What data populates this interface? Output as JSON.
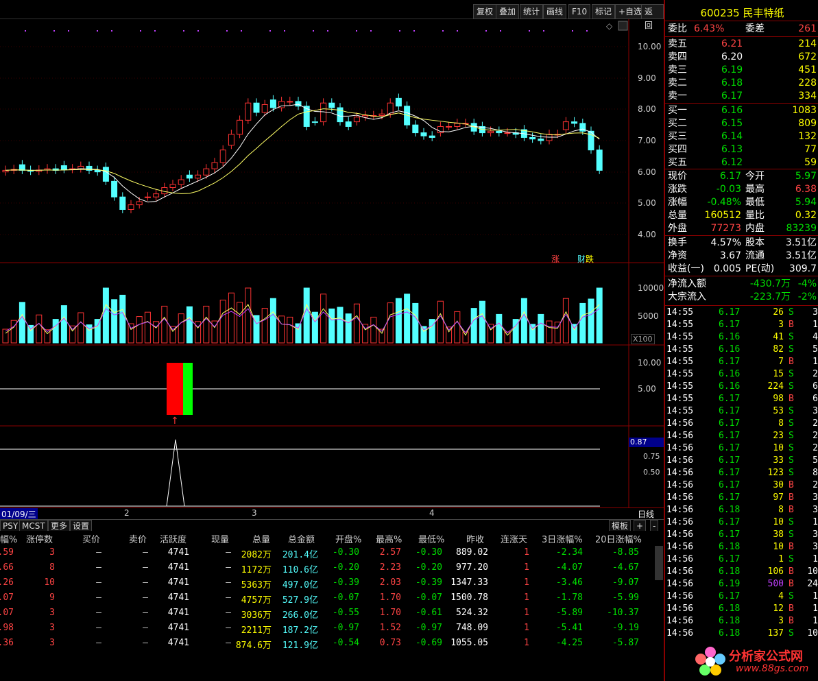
{
  "toolbar": {
    "buttons": [
      "复权",
      "叠加",
      "统计",
      "画线",
      "F10",
      "标记",
      "+自选",
      "返回"
    ]
  },
  "stock": {
    "code": "600235",
    "name": "民丰特纸"
  },
  "price_axis": [
    "10.00",
    "9.00",
    "8.00",
    "7.00",
    "6.00",
    "5.00",
    "4.00"
  ],
  "volume_axis": [
    "10000",
    "5000"
  ],
  "volume_unit": "X100",
  "indicator_axis": [
    "10.00",
    "5.00"
  ],
  "indicator_labels": {
    "up": "涨",
    "fin": "财",
    "down": "跌"
  },
  "pane4_axis": [
    "0.87",
    "0.75",
    "0.50"
  ],
  "date_axis": {
    "start": "01/09/三",
    "ticks": [
      "2",
      "3",
      "4"
    ],
    "period": "日线"
  },
  "tabs": [
    "PSY",
    "MCST",
    "更多",
    "设置"
  ],
  "tab_right": {
    "template": "模板",
    "plus": "+",
    "minus": "-"
  },
  "table": {
    "headers": [
      "幅%",
      "涨停数",
      "买价",
      "卖价",
      "活跃度",
      "现量",
      "总量",
      "总金额",
      "开盘%",
      "最高%",
      "最低%",
      "昨收",
      "连涨天",
      "3日涨幅%",
      "20日涨幅%"
    ],
    "rows": [
      [
        ".59",
        "3",
        "–",
        "–",
        "4741",
        "–",
        "2082万",
        "201.4亿",
        "-0.30",
        "2.57",
        "-0.30",
        "889.02",
        "1",
        "-2.34",
        "-8.85"
      ],
      [
        ".66",
        "8",
        "–",
        "–",
        "4741",
        "–",
        "1172万",
        "110.6亿",
        "-0.20",
        "2.23",
        "-0.20",
        "977.20",
        "1",
        "-4.07",
        "-4.67"
      ],
      [
        ".26",
        "10",
        "–",
        "–",
        "4741",
        "–",
        "5363万",
        "497.0亿",
        "-0.39",
        "2.03",
        "-0.39",
        "1347.33",
        "1",
        "-3.46",
        "-9.07"
      ],
      [
        ".07",
        "9",
        "–",
        "–",
        "4741",
        "–",
        "4757万",
        "527.9亿",
        "-0.07",
        "1.70",
        "-0.07",
        "1500.78",
        "1",
        "-1.78",
        "-5.99"
      ],
      [
        ".07",
        "3",
        "–",
        "–",
        "4741",
        "–",
        "3036万",
        "266.0亿",
        "-0.55",
        "1.70",
        "-0.61",
        "524.32",
        "1",
        "-5.89",
        "-10.37"
      ],
      [
        ".98",
        "3",
        "–",
        "–",
        "4741",
        "–",
        "2211万",
        "187.2亿",
        "-0.97",
        "1.52",
        "-0.97",
        "748.09",
        "1",
        "-5.41",
        "-9.19"
      ],
      [
        ".36",
        "3",
        "–",
        "–",
        "4741",
        "–",
        "874.6万",
        "121.9亿",
        "-0.54",
        "0.73",
        "-0.69",
        "1055.05",
        "1",
        "-4.25",
        "-5.87"
      ]
    ]
  },
  "orderbook": {
    "weibi_label": "委比",
    "weibi": "6.43%",
    "weicha_label": "委差",
    "weicha": "261",
    "sells": [
      [
        "卖五",
        "6.21",
        "214"
      ],
      [
        "卖四",
        "6.20",
        "672"
      ],
      [
        "卖三",
        "6.19",
        "451"
      ],
      [
        "卖二",
        "6.18",
        "228"
      ],
      [
        "卖一",
        "6.17",
        "334"
      ]
    ],
    "buys": [
      [
        "买一",
        "6.16",
        "1083"
      ],
      [
        "买二",
        "6.15",
        "809"
      ],
      [
        "买三",
        "6.14",
        "132"
      ],
      [
        "买四",
        "6.13",
        "77"
      ],
      [
        "买五",
        "6.12",
        "59"
      ]
    ]
  },
  "quote": [
    [
      "现价",
      "6.17",
      "今开",
      "5.97"
    ],
    [
      "涨跌",
      "-0.03",
      "最高",
      "6.38"
    ],
    [
      "涨幅",
      "-0.48%",
      "最低",
      "5.94"
    ],
    [
      "总量",
      "160512",
      "量比",
      "0.32"
    ],
    [
      "外盘",
      "77273",
      "内盘",
      "83239"
    ]
  ],
  "fundamentals": [
    [
      "换手",
      "4.57%",
      "股本",
      "3.51亿"
    ],
    [
      "净资",
      "3.67",
      "流通",
      "3.51亿"
    ],
    [
      "收益(一)",
      "0.005",
      "PE(动)",
      "309.7"
    ]
  ],
  "flows": [
    [
      "净流入额",
      "-430.7万",
      "-4%"
    ],
    [
      "大宗流入",
      "-223.7万",
      "-2%"
    ]
  ],
  "ticks": [
    [
      "14:55",
      "6.17",
      "26",
      "S",
      "3"
    ],
    [
      "14:55",
      "6.17",
      "3",
      "B",
      "1"
    ],
    [
      "14:55",
      "6.16",
      "41",
      "S",
      "4"
    ],
    [
      "14:55",
      "6.16",
      "82",
      "S",
      "5"
    ],
    [
      "14:55",
      "6.17",
      "7",
      "B",
      "1"
    ],
    [
      "14:55",
      "6.16",
      "15",
      "S",
      "2"
    ],
    [
      "14:55",
      "6.16",
      "224",
      "S",
      "6"
    ],
    [
      "14:55",
      "6.17",
      "98",
      "B",
      "6"
    ],
    [
      "14:55",
      "6.17",
      "53",
      "S",
      "3"
    ],
    [
      "14:56",
      "6.17",
      "8",
      "S",
      "2"
    ],
    [
      "14:56",
      "6.17",
      "23",
      "S",
      "2"
    ],
    [
      "14:56",
      "6.17",
      "10",
      "S",
      "2"
    ],
    [
      "14:56",
      "6.17",
      "33",
      "S",
      "5"
    ],
    [
      "14:56",
      "6.17",
      "123",
      "S",
      "8"
    ],
    [
      "14:56",
      "6.17",
      "30",
      "B",
      "2"
    ],
    [
      "14:56",
      "6.17",
      "97",
      "B",
      "3"
    ],
    [
      "14:56",
      "6.18",
      "8",
      "B",
      "3"
    ],
    [
      "14:56",
      "6.17",
      "10",
      "S",
      "1"
    ],
    [
      "14:56",
      "6.17",
      "38",
      "S",
      "3"
    ],
    [
      "14:56",
      "6.18",
      "10",
      "B",
      "3"
    ],
    [
      "14:56",
      "6.17",
      "1",
      "S",
      "1"
    ],
    [
      "14:56",
      "6.18",
      "106",
      "B",
      "10"
    ],
    [
      "14:56",
      "6.19",
      "500",
      "B",
      "24"
    ],
    [
      "14:56",
      "6.17",
      "4",
      "S",
      "1"
    ],
    [
      "14:56",
      "6.18",
      "12",
      "B",
      "1"
    ],
    [
      "14:56",
      "6.18",
      "3",
      "B",
      "1"
    ],
    [
      "14:56",
      "6.18",
      "137",
      "S",
      "10"
    ]
  ],
  "watermark": {
    "title": "分析家公式网",
    "url": "www.88gs.com"
  }
}
